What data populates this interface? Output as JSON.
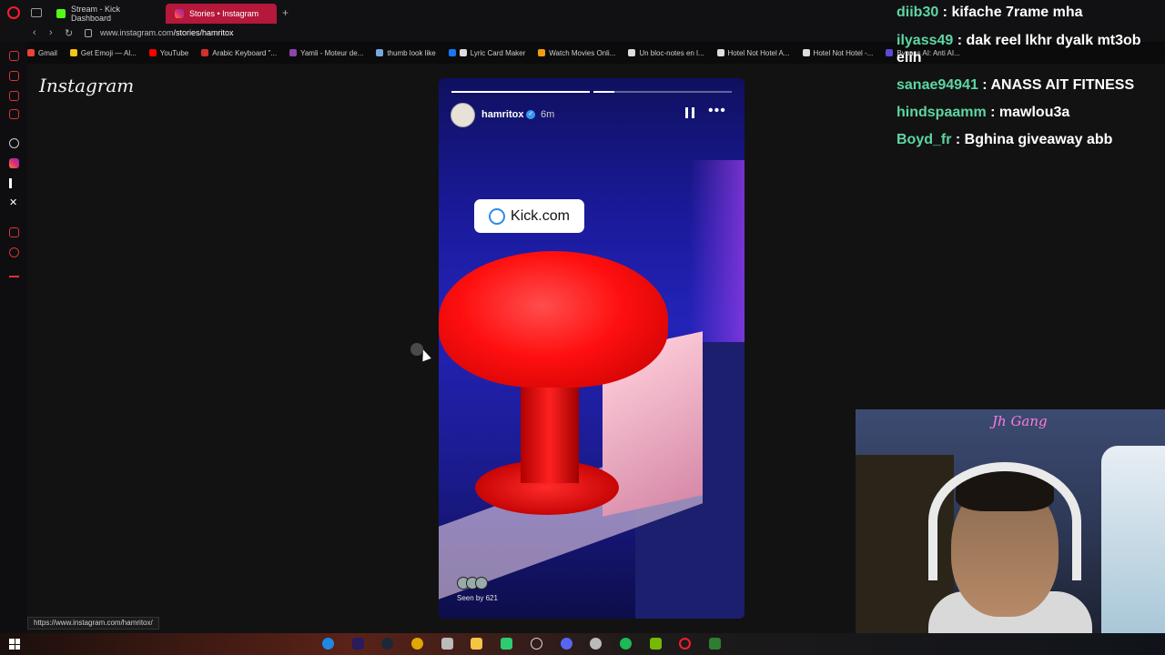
{
  "browser": {
    "tabs": [
      {
        "label": "Stream - Kick Dashboard",
        "active": false
      },
      {
        "label": "Stories • Instagram",
        "active": true
      }
    ],
    "url": {
      "host": "www.instagram.com",
      "path": "/stories/hamritox"
    },
    "bookmarks": [
      "Gmail",
      "Get Emoji — Al...",
      "YouTube",
      "Arabic Keyboard \"...",
      "Yamli - Moteur de...",
      "thumb look like",
      "Lyric Card Maker",
      "Watch Movies Onli...",
      "Un bloc-notes en l...",
      "Hotel Not Hotel A...",
      "Hotel Not Hotel -...",
      "Bypass AI: Anti AI..."
    ],
    "status_url": "https://www.instagram.com/hamritox/"
  },
  "instagram": {
    "logo": "Instagram",
    "story": {
      "username": "hamritox",
      "time": "6m",
      "link_sticker": "Kick.com",
      "seen_by": "Seen by 621",
      "segments": 2,
      "active_segment": 2,
      "segment_progress": 0.15
    }
  },
  "chat": [
    {
      "user": "diib30",
      "text": "kifache 7rame mha"
    },
    {
      "user": "ilyass49",
      "text": "dak reel lkhr dyalk mt3ob elih"
    },
    {
      "user": "sanae94941",
      "text": "ANASS AIT FITNESS"
    },
    {
      "user": "hindspaamm",
      "text": "mawlou3a"
    },
    {
      "user": "Boyd_fr",
      "text": "Bghina giveaway abb"
    }
  ],
  "webcam": {
    "sign": "Jh Gang"
  },
  "colors": {
    "accent_tab": "#b5183a",
    "chat_user": "#5dd6a3",
    "link": "#2e8be6",
    "lamp": "#ff0f0f"
  }
}
